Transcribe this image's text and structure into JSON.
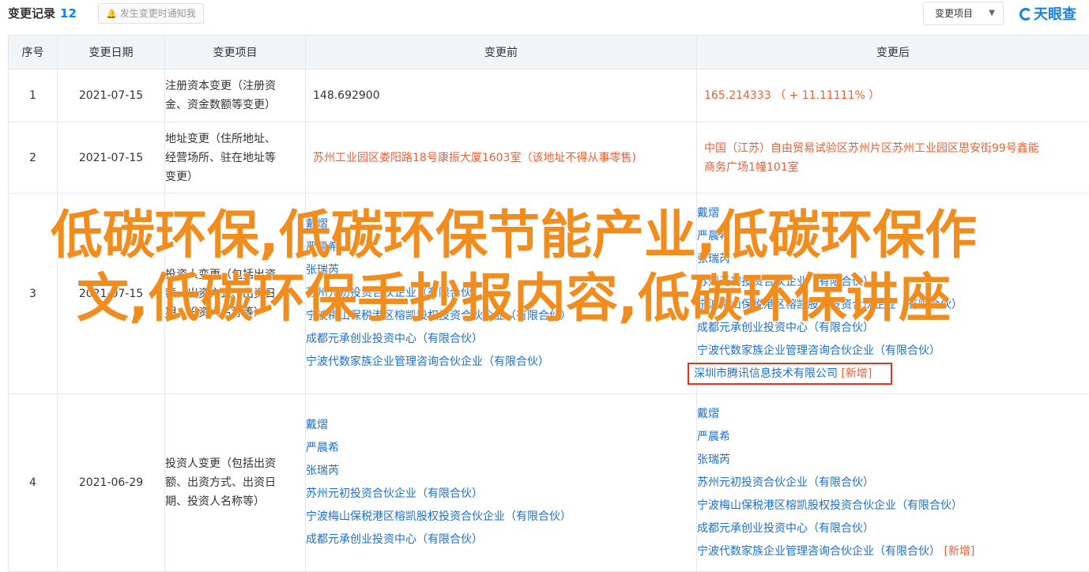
{
  "header": {
    "title": "变更记录",
    "count": "12",
    "notify_label": "发生变更时通知我",
    "filter_label": "变更项目",
    "logo_text": "天眼查"
  },
  "table": {
    "columns": [
      "序号",
      "变更日期",
      "变更项目",
      "变更前",
      "变更后"
    ],
    "rows": [
      {
        "no": "1",
        "date": "2021-07-15",
        "item": [
          "注册资本变更（注册资",
          "金、资金数额等变更）"
        ],
        "before": [
          "148.692900"
        ],
        "after": [
          "165.214333 （ + 11.11111% ）"
        ]
      },
      {
        "no": "2",
        "date": "2021-07-15",
        "item": [
          "地址变更（住所地址、",
          "经营场所、驻在地址等",
          "变更）"
        ],
        "before": [
          "苏州工业园区娄阳路18号康振大厦1603室（该地址不得从事零售)"
        ],
        "after": [
          "中国（江苏）自由贸易试验区苏州片区苏州工业园区思安街99号鑫能",
          "商务广场1幢101室"
        ]
      },
      {
        "no": "3",
        "date": "2021-07-15",
        "item": [
          "投资人变更（包括出资",
          "额、出资方式、出资日",
          "期、投资人名称等）"
        ],
        "before": [
          "戴熠",
          "严晨希",
          "张瑞芮",
          "苏州元初投资合伙企业（有限合伙）",
          "宁波梅山保税港区榕凯股权投资合伙企业（有限合伙）",
          "成都元承创业投资中心（有限合伙）",
          "宁波代数家族企业管理咨询合伙企业（有限合伙）"
        ],
        "after": [
          "戴熠",
          "严晨希",
          "张瑞芮",
          "苏州元初投资合伙企业（有限合伙）",
          "宁波梅山保税港区榕凯股权投资合伙企业（有限合伙）",
          "成都元承创业投资中心（有限合伙）",
          "宁波代数家族企业管理咨询合伙企业（有限合伙）"
        ],
        "after_added": "深圳市腾讯信息技术有限公司",
        "added_tag": "[新增]"
      },
      {
        "no": "4",
        "date": "2021-06-29",
        "item": [
          "投资人变更（包括出资",
          "额、出资方式、出资日",
          "期、投资人名称等）"
        ],
        "before": [
          "戴熠",
          "严晨希",
          "张瑞芮",
          "苏州元初投资合伙企业（有限合伙）",
          "宁波梅山保税港区榕凯股权投资合伙企业（有限合伙）",
          "成都元承创业投资中心（有限合伙）"
        ],
        "after": [
          "戴熠",
          "严晨希",
          "张瑞芮",
          "苏州元初投资合伙企业（有限合伙）",
          "宁波梅山保税港区榕凯股权投资合伙企业（有限合伙）",
          "成都元承创业投资中心（有限合伙）"
        ],
        "after_last": "宁波代数家族企业管理咨询合伙企业（有限合伙）",
        "added_tag": "[新增]"
      }
    ]
  },
  "overlay": {
    "text": "低碳环保,低碳环保节能产业,低碳环保作文,低碳环保手抄报内容,低碳环保讲座"
  }
}
